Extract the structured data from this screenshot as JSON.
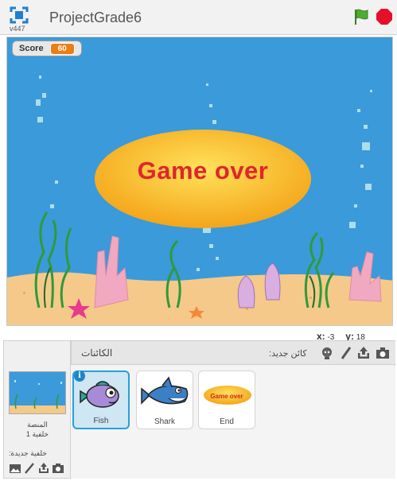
{
  "titlebar": {
    "version": "v447",
    "project_title": "ProjectGrade6",
    "icons": [
      "fullscreen-icon",
      "green-flag-icon",
      "stop-icon"
    ]
  },
  "stage": {
    "score_label": "Score",
    "score_value": "60",
    "game_over_text": "Game over"
  },
  "coords": {
    "x_label": "x:",
    "x_value": "-3",
    "y_label": "y:",
    "y_value": "18"
  },
  "panel": {
    "sprites_label": "الكائنات",
    "new_sprite_label": ":كائن جديد",
    "stage_name": "المنصة",
    "backdrop_count": "خلفية 1",
    "new_backdrop_label": ":خلفية جديدة",
    "sprites": [
      {
        "name": "Fish",
        "selected": true
      },
      {
        "name": "Shark",
        "selected": false
      },
      {
        "name": "End",
        "selected": false,
        "costume_text": "Game over"
      }
    ]
  },
  "colors": {
    "stage_water": "#3b9ad9",
    "sand": "#f5c98a",
    "game_over_text": "#e0252b",
    "score_badge": "#ee7d16",
    "selected_border": "#27a0d8"
  }
}
